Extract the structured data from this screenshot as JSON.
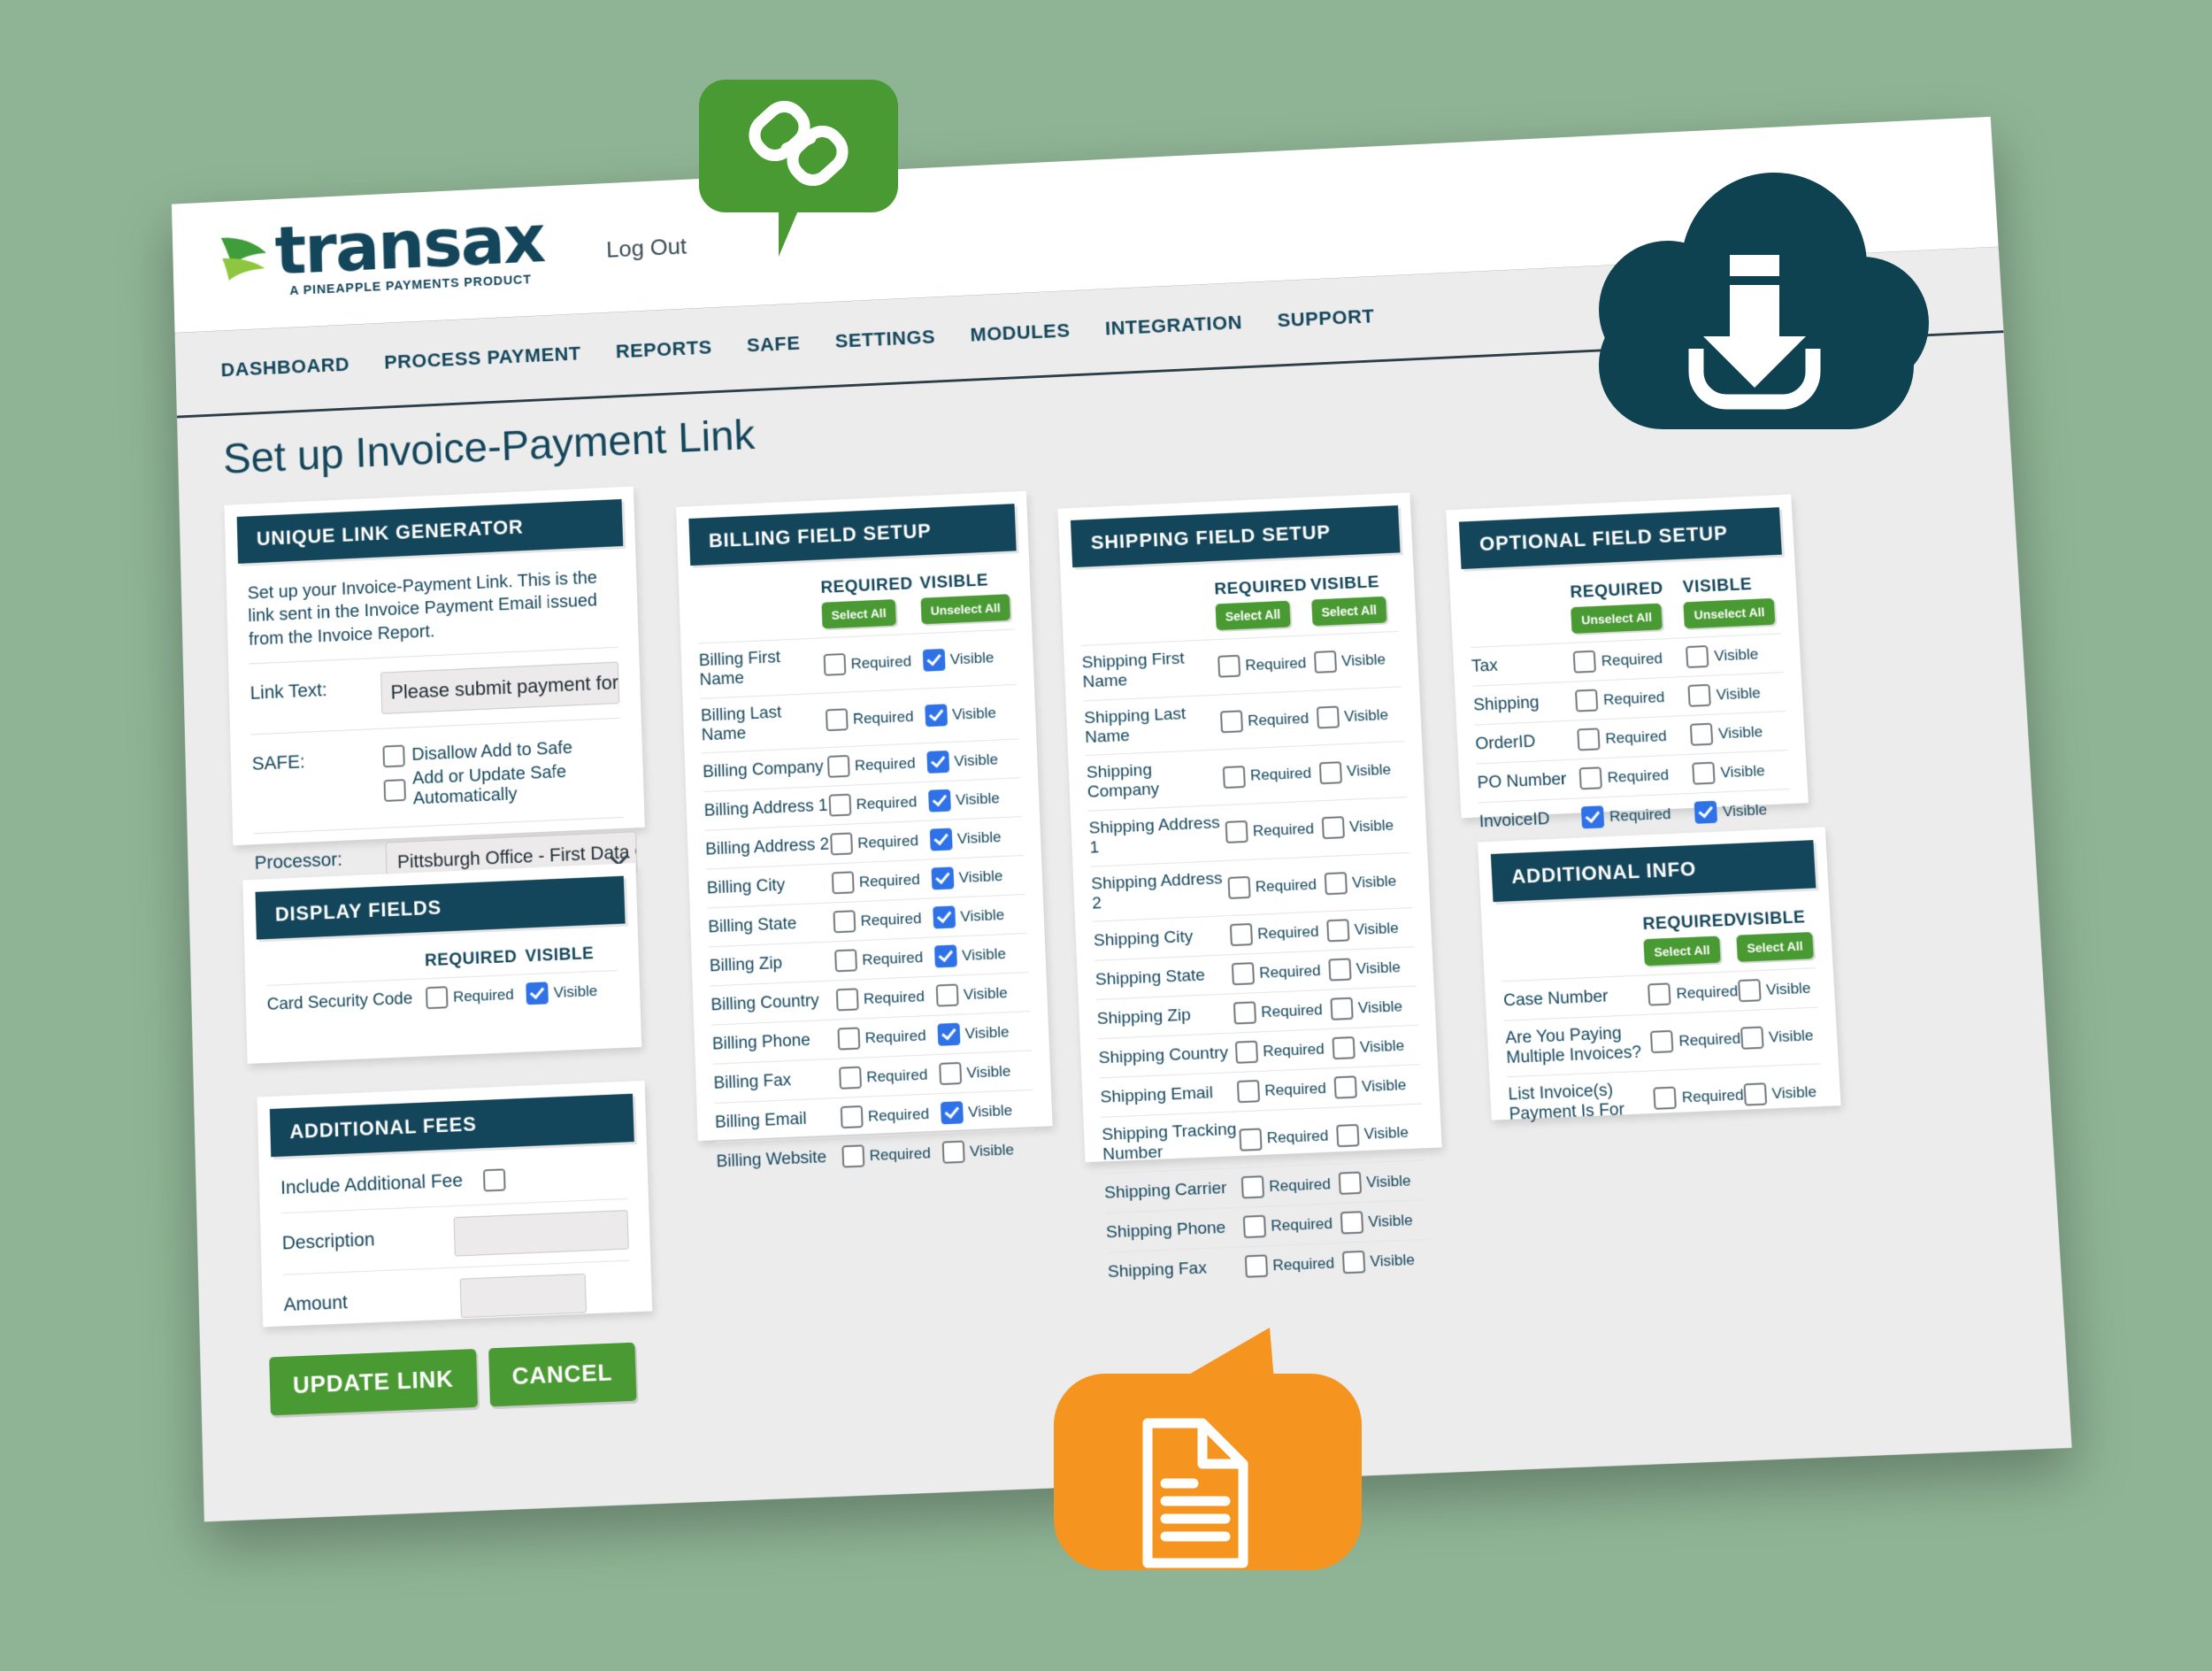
{
  "brand": {
    "name": "transax",
    "tagline": "A PINEAPPLE PAYMENTS PRODUCT",
    "logo_icon": "leaf-mark-icon",
    "accent_green": "#4a9a34",
    "dark_teal": "#14465b",
    "checkbox_blue": "#2f72e8",
    "page_background": "#8fb495"
  },
  "header": {
    "logout_label": "Log Out"
  },
  "nav": {
    "items": [
      {
        "label": "DASHBOARD"
      },
      {
        "label": "PROCESS PAYMENT"
      },
      {
        "label": "REPORTS"
      },
      {
        "label": "SAFE"
      },
      {
        "label": "SETTINGS"
      },
      {
        "label": "MODULES"
      },
      {
        "label": "INTEGRATION"
      },
      {
        "label": "SUPPORT"
      }
    ]
  },
  "page": {
    "title": "Set up Invoice-Payment Link"
  },
  "unique_link_generator": {
    "heading": "UNIQUE LINK GENERATOR",
    "intro": "Set up your Invoice-Payment Link. This is the link sent in the Invoice Payment Email issued from the Invoice Report.",
    "link_text_label": "Link Text:",
    "link_text_value": "Please submit payment for your invo",
    "safe_label": "SAFE:",
    "safe_options": [
      {
        "label": "Disallow Add to Safe",
        "checked": false
      },
      {
        "label": "Add or Update Safe Automatically",
        "checked": false
      }
    ],
    "processor_label": "Processor:",
    "processor_value": "Pittsburgh Office - First Data Or"
  },
  "display_fields": {
    "heading": "DISPLAY FIELDS",
    "required_header": "REQUIRED",
    "visible_header": "VISIBLE",
    "rows": [
      {
        "name": "Card Security Code",
        "required_label": "Required",
        "required": false,
        "visible_label": "Visible",
        "visible": true
      }
    ]
  },
  "additional_fees": {
    "heading": "ADDITIONAL FEES",
    "include_label": "Include Additional Fee",
    "include_checked": false,
    "description_label": "Description",
    "description_value": "",
    "amount_label": "Amount",
    "amount_value": ""
  },
  "billing_field_setup": {
    "heading": "BILLING FIELD SETUP",
    "required_header": "REQUIRED",
    "visible_header": "VISIBLE",
    "required_button": "Select All",
    "visible_button": "Unselect All",
    "required_label": "Required",
    "visible_label": "Visible",
    "rows": [
      {
        "name": "Billing First Name",
        "required": false,
        "visible": true
      },
      {
        "name": "Billing Last Name",
        "required": false,
        "visible": true
      },
      {
        "name": "Billing Company",
        "required": false,
        "visible": true
      },
      {
        "name": "Billing Address 1",
        "required": false,
        "visible": true
      },
      {
        "name": "Billing Address 2",
        "required": false,
        "visible": true
      },
      {
        "name": "Billing City",
        "required": false,
        "visible": true
      },
      {
        "name": "Billing State",
        "required": false,
        "visible": true
      },
      {
        "name": "Billing Zip",
        "required": false,
        "visible": true
      },
      {
        "name": "Billing Country",
        "required": false,
        "visible": false
      },
      {
        "name": "Billing Phone",
        "required": false,
        "visible": true
      },
      {
        "name": "Billing Fax",
        "required": false,
        "visible": false
      },
      {
        "name": "Billing Email",
        "required": false,
        "visible": true
      },
      {
        "name": "Billing Website",
        "required": false,
        "visible": false
      }
    ]
  },
  "shipping_field_setup": {
    "heading": "SHIPPING FIELD SETUP",
    "required_header": "REQUIRED",
    "visible_header": "VISIBLE",
    "required_button": "Select All",
    "visible_button": "Select All",
    "required_label": "Required",
    "visible_label": "Visible",
    "rows": [
      {
        "name": "Shipping First Name",
        "required": false,
        "visible": false
      },
      {
        "name": "Shipping Last Name",
        "required": false,
        "visible": false
      },
      {
        "name": "Shipping Company",
        "required": false,
        "visible": false
      },
      {
        "name": "Shipping Address 1",
        "required": false,
        "visible": false
      },
      {
        "name": "Shipping Address 2",
        "required": false,
        "visible": false
      },
      {
        "name": "Shipping City",
        "required": false,
        "visible": false
      },
      {
        "name": "Shipping State",
        "required": false,
        "visible": false
      },
      {
        "name": "Shipping Zip",
        "required": false,
        "visible": false
      },
      {
        "name": "Shipping Country",
        "required": false,
        "visible": false
      },
      {
        "name": "Shipping Email",
        "required": false,
        "visible": false
      },
      {
        "name": "Shipping Tracking Number",
        "required": false,
        "visible": false
      },
      {
        "name": "Shipping Carrier",
        "required": false,
        "visible": false
      },
      {
        "name": "Shipping Phone",
        "required": false,
        "visible": false
      },
      {
        "name": "Shipping Fax",
        "required": false,
        "visible": false
      }
    ]
  },
  "optional_field_setup": {
    "heading": "OPTIONAL FIELD SETUP",
    "required_header": "REQUIRED",
    "visible_header": "VISIBLE",
    "required_button": "Unselect All",
    "visible_button": "Unselect All",
    "required_label": "Required",
    "visible_label": "Visible",
    "rows": [
      {
        "name": "Tax",
        "required": false,
        "visible": false
      },
      {
        "name": "Shipping",
        "required": false,
        "visible": false
      },
      {
        "name": "OrderID",
        "required": false,
        "visible": false
      },
      {
        "name": "PO Number",
        "required": false,
        "visible": false
      },
      {
        "name": "InvoiceID",
        "required": true,
        "visible": true
      }
    ]
  },
  "additional_info": {
    "heading": "ADDITIONAL INFO",
    "required_header": "REQUIRED",
    "visible_header": "VISIBLE",
    "required_button": "Select All",
    "visible_button": "Select All",
    "required_label": "Required",
    "visible_label": "Visible",
    "rows": [
      {
        "name": "Case Number",
        "required": false,
        "visible": false
      },
      {
        "name": "Are You Paying Multiple Invoices?",
        "required": false,
        "visible": false
      },
      {
        "name": "List Invoice(s) Payment Is For",
        "required": false,
        "visible": false
      }
    ]
  },
  "actions": {
    "update_label": "UPDATE LINK",
    "cancel_label": "CANCEL"
  },
  "decorations": [
    {
      "id": "link-badge",
      "icon": "chain-link-icon",
      "color": "#4a9a34"
    },
    {
      "id": "cloud-badge",
      "icon": "cloud-download-icon",
      "color": "#0e4250"
    },
    {
      "id": "document-badge",
      "icon": "document-icon",
      "color": "#f5941f"
    }
  ]
}
